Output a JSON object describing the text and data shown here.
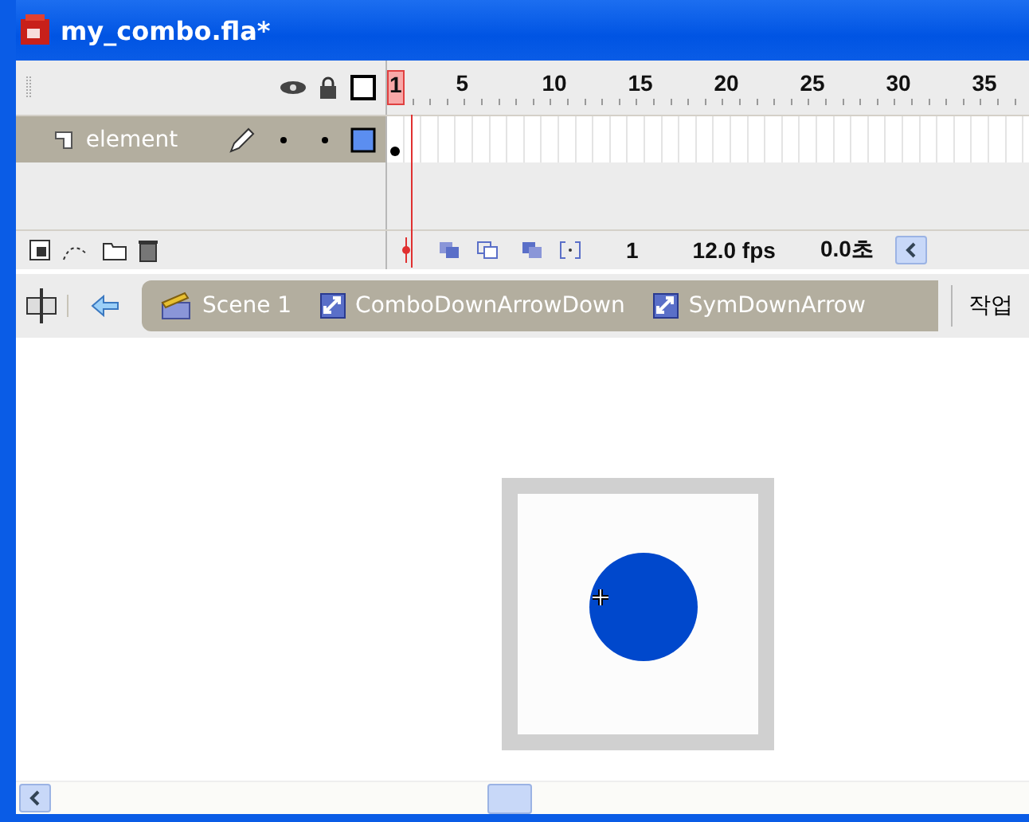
{
  "window": {
    "title": "my_combo.fla*"
  },
  "timeline": {
    "ruler": [
      "1",
      "5",
      "10",
      "15",
      "20",
      "25",
      "30",
      "35"
    ],
    "layers": [
      {
        "name": "element",
        "selected": true,
        "color": "#5b8ef0"
      }
    ],
    "status": {
      "frame": "1",
      "fps": "12.0 fps",
      "time": "0.0초"
    }
  },
  "edit_bar": {
    "breadcrumbs": [
      {
        "kind": "scene",
        "label": "Scene 1"
      },
      {
        "kind": "symbol",
        "label": "ComboDownArrowDown"
      },
      {
        "kind": "symbol",
        "label": "SymDownArrow"
      }
    ],
    "workspace": "작업"
  }
}
